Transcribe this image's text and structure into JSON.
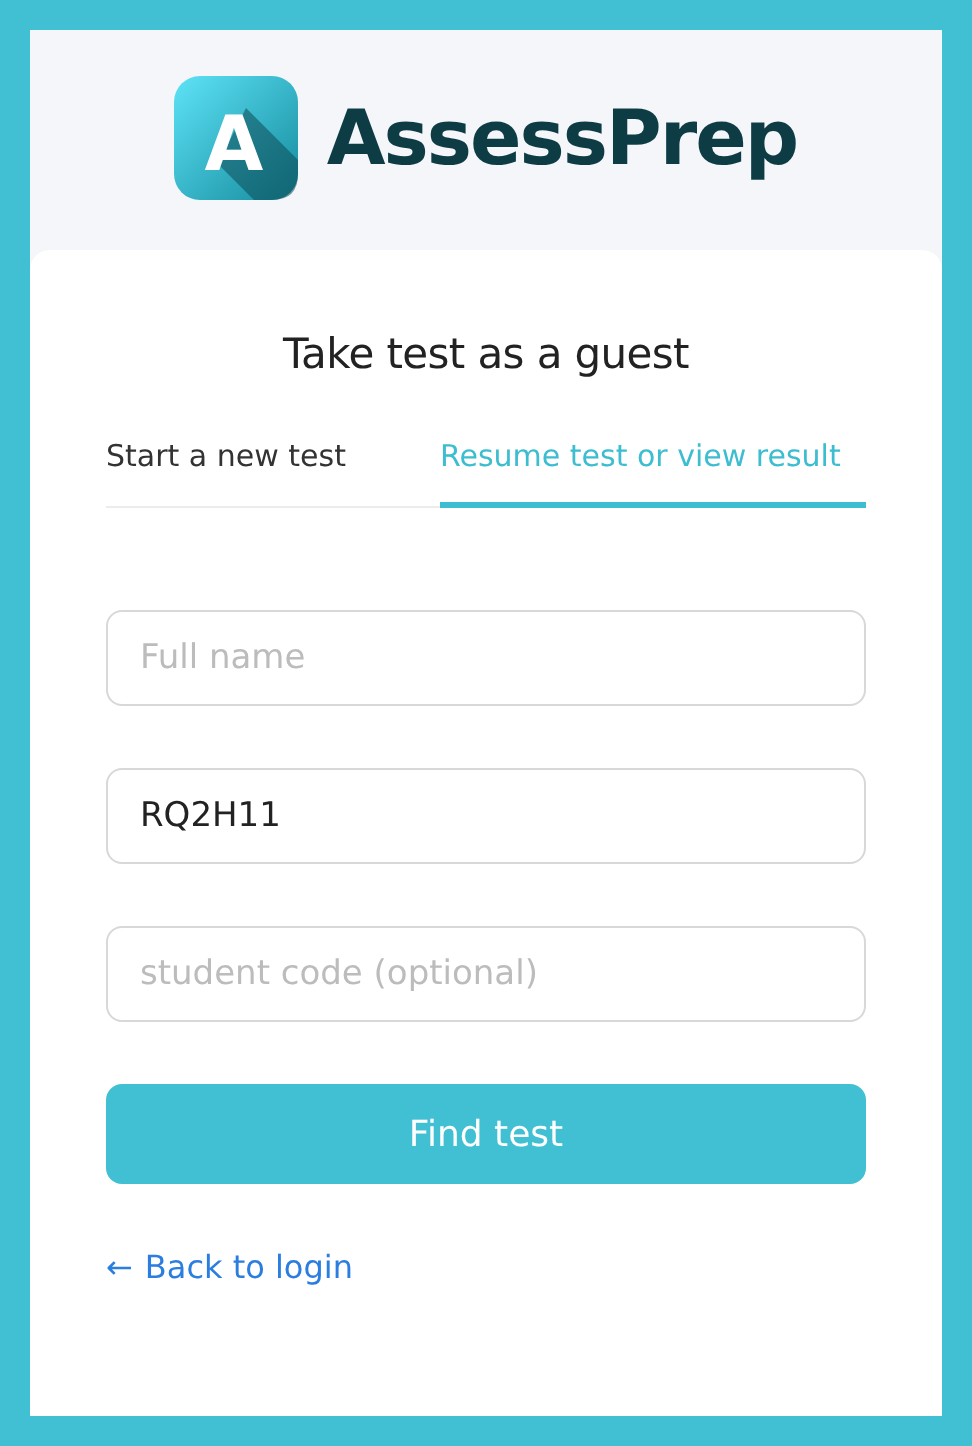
{
  "brand": {
    "name": "AssessPrep",
    "logo_letter": "A"
  },
  "heading": "Take test as a guest",
  "tabs": [
    {
      "label": "Start a new test",
      "selected": false
    },
    {
      "label": "Resume test or view result",
      "selected": true
    }
  ],
  "fields": [
    {
      "placeholder": "Full name"
    },
    {
      "value": "RQ2H11"
    },
    {
      "placeholder": "student code (optional)"
    }
  ],
  "submit_button": "Find test",
  "back_link": {
    "icon": "←",
    "label": "Back to login"
  }
}
